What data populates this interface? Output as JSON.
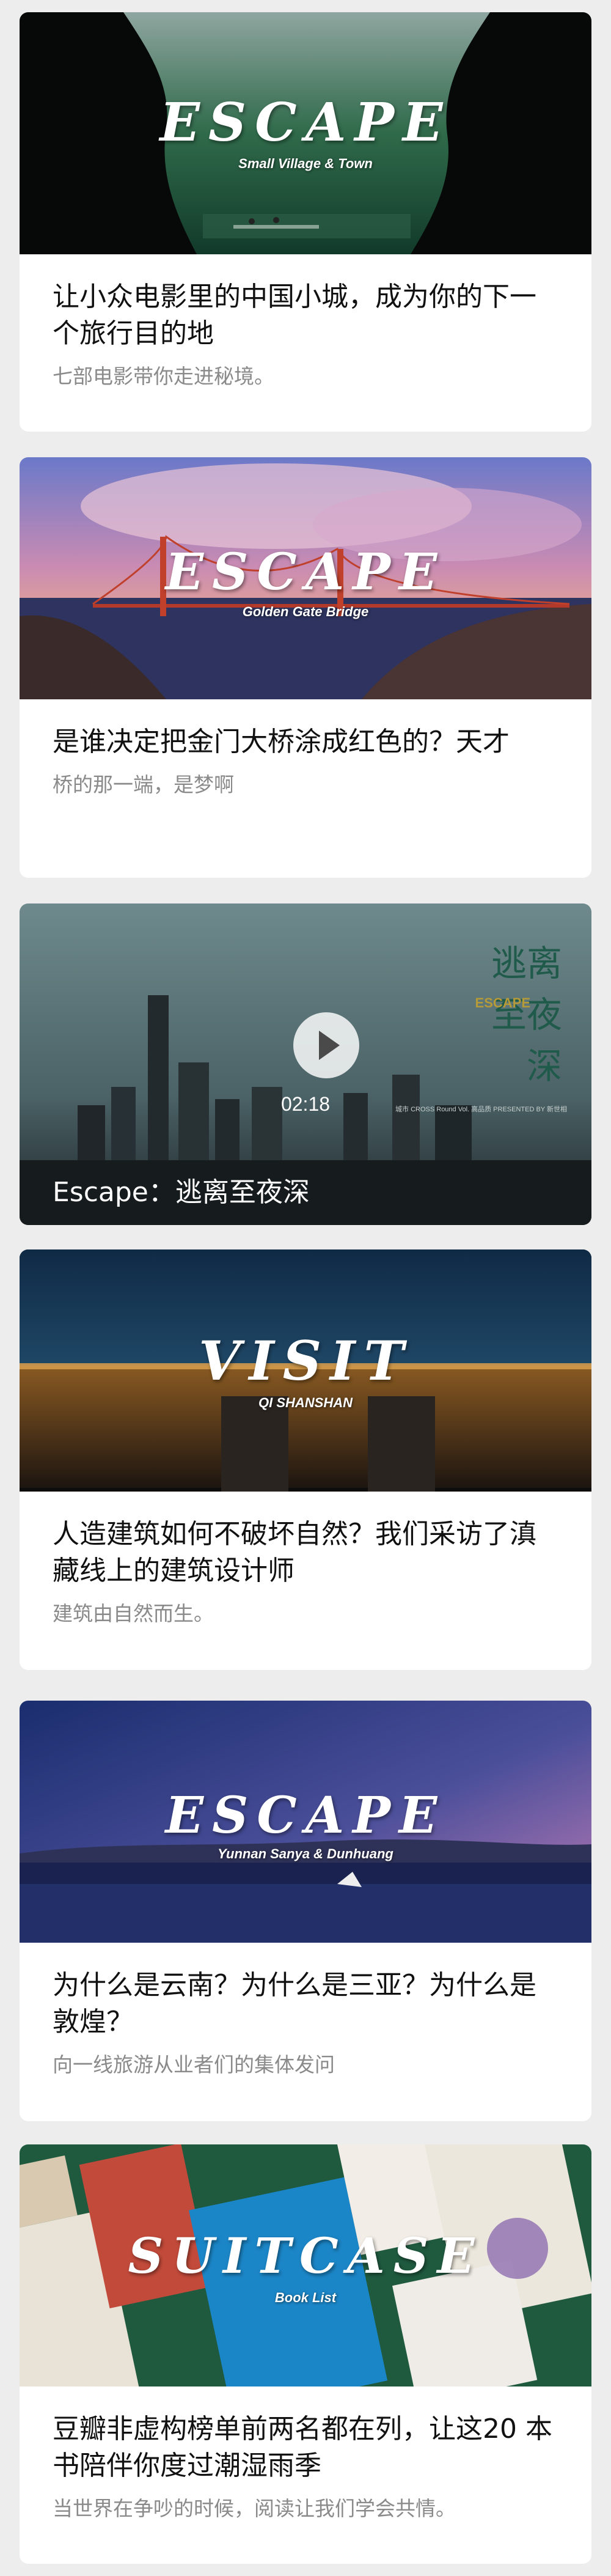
{
  "feed": {
    "cards": [
      {
        "overlay_title": "ESCAPE",
        "overlay_subtitle": "Small Village & Town",
        "title": "让小众电影里的中国小城，成为你的下一个旅行目的地",
        "description": "七部电影带你走进秘境。"
      },
      {
        "overlay_title": "ESCAPE",
        "overlay_subtitle": "Golden Gate Bridge",
        "title": "是谁决定把金门大桥涂成红色的？天才",
        "description": "桥的那一端，是梦啊"
      },
      {
        "type": "video",
        "duration": "02:18",
        "title": "Escape：逃离至夜深",
        "vertical_title": "逃离至夜深",
        "escape_mark": "ESCAPE",
        "credits": "城市 CROSS Round Vol. 高品质 PRESENTED BY 新世相"
      },
      {
        "overlay_title": "VISIT",
        "overlay_subtitle": "QI SHANSHAN",
        "title": "人造建筑如何不破坏自然？我们采访了滇藏线上的建筑设计师",
        "description": "建筑由自然而生。"
      },
      {
        "overlay_title": "ESCAPE",
        "overlay_subtitle": "Yunnan Sanya & Dunhuang",
        "title": "为什么是云南？为什么是三亚？为什么是敦煌？",
        "description": "向一线旅游从业者们的集体发问"
      },
      {
        "overlay_title": "SUITCASE",
        "overlay_subtitle": "Book List",
        "title": "豆瓣非虚构榜单前两名都在列，让这20 本书陪伴你度过潮湿雨季",
        "description": "当世界在争吵的时候，阅读让我们学会共情。"
      }
    ]
  },
  "colors": {
    "page_bg": "#ededed",
    "card_bg": "#ffffff",
    "title_text": "#111111",
    "desc_text": "#8a8a8a"
  }
}
